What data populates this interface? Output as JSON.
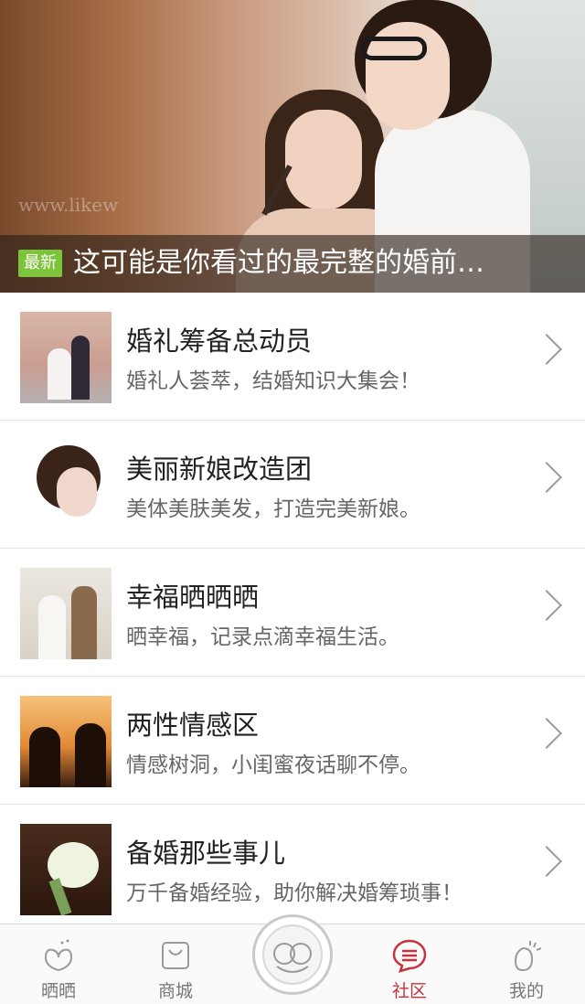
{
  "banner": {
    "badge": "最新",
    "title": "这可能是你看过的最完整的婚前…",
    "watermark": "www.likew"
  },
  "list": [
    {
      "title": "婚礼筹备总动员",
      "desc": "婚礼人荟萃，结婚知识大集会！"
    },
    {
      "title": "美丽新娘改造团",
      "desc": "美体美肤美发，打造完美新娘。"
    },
    {
      "title": "幸福晒晒晒",
      "desc": "晒幸福，记录点滴幸福生活。"
    },
    {
      "title": "两性情感区",
      "desc": "情感树洞，小闺蜜夜话聊不停。"
    },
    {
      "title": "备婚那些事儿",
      "desc": "万千备婚经验，助你解决婚筹琐事！"
    }
  ],
  "tabs": [
    {
      "label": "晒晒",
      "icon": "heart-hands-icon"
    },
    {
      "label": "商城",
      "icon": "shopping-bag-icon"
    },
    {
      "label": "社区",
      "icon": "chat-bubble-icon",
      "active": true
    },
    {
      "label": "我的",
      "icon": "profile-icon"
    }
  ],
  "colors": {
    "accent": "#c8313a",
    "badge": "#7cc53a"
  }
}
